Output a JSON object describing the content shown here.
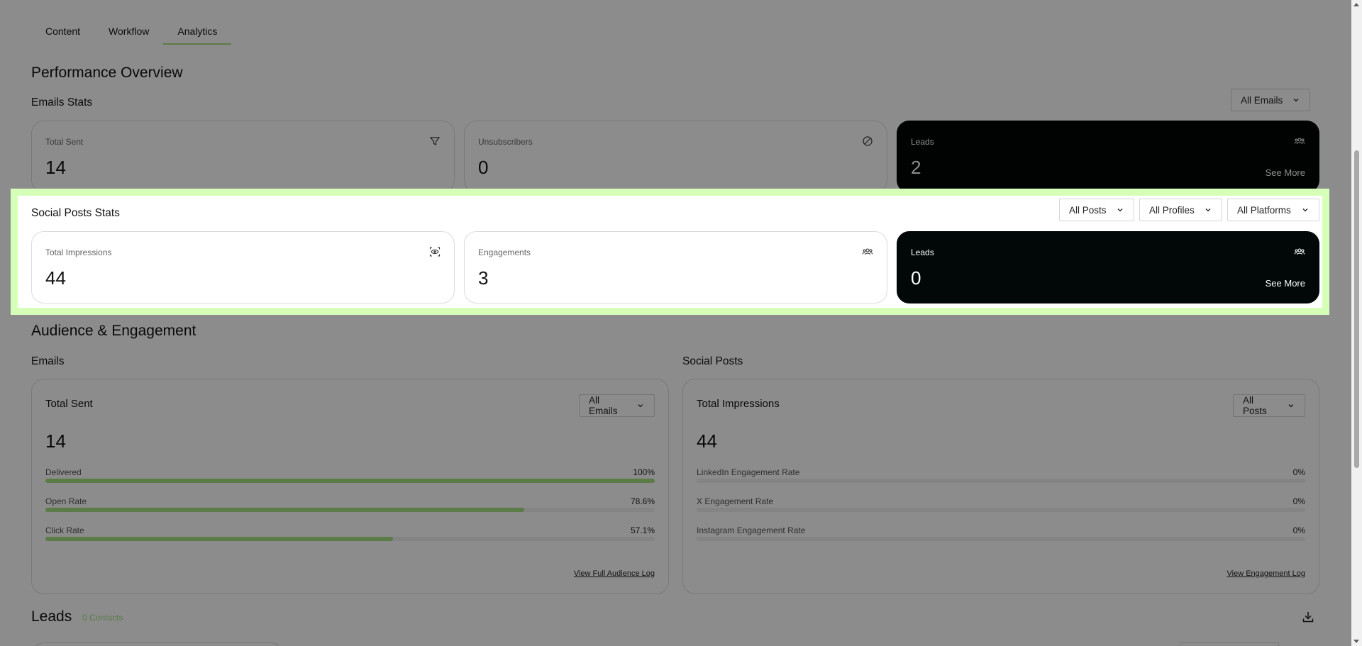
{
  "tabs": [
    {
      "label": "Content"
    },
    {
      "label": "Workflow"
    },
    {
      "label": "Analytics"
    }
  ],
  "performance": {
    "title": "Performance Overview",
    "emails_stats": {
      "title": "Emails Stats",
      "filter": "All Emails",
      "cards": [
        {
          "label": "Total Sent",
          "value": "14",
          "icon": "filter-icon"
        },
        {
          "label": "Unsubscribers",
          "value": "0",
          "icon": "prohibited-icon"
        },
        {
          "label": "Leads",
          "value": "2",
          "icon": "users-icon",
          "link": "See More"
        }
      ]
    },
    "social_stats": {
      "title": "Social Posts Stats",
      "filters": [
        "All Posts",
        "All Profiles",
        "All Platforms"
      ],
      "cards": [
        {
          "label": "Total Impressions",
          "value": "44",
          "icon": "eye-scan-icon"
        },
        {
          "label": "Engagements",
          "value": "3",
          "icon": "users-icon"
        },
        {
          "label": "Leads",
          "value": "0",
          "icon": "users-icon",
          "link": "See More"
        }
      ]
    }
  },
  "audience": {
    "title": "Audience & Engagement",
    "emails": {
      "section": "Emails",
      "title": "Total Sent",
      "filter": "All Emails",
      "value": "14",
      "metrics": [
        {
          "label": "Delivered",
          "value": "100%",
          "fraction": 1.0
        },
        {
          "label": "Open Rate",
          "value": "78.6%",
          "fraction": 0.786
        },
        {
          "label": "Click Rate",
          "value": "57.1%",
          "fraction": 0.571
        }
      ],
      "link": "View Full Audience Log"
    },
    "social": {
      "section": "Social Posts",
      "title": "Total Impressions",
      "filter": "All Posts",
      "value": "44",
      "metrics": [
        {
          "label": "LinkedIn Engagement Rate",
          "value": "0%",
          "fraction": 0
        },
        {
          "label": "X Engagement Rate",
          "value": "0%",
          "fraction": 0
        },
        {
          "label": "Instagram Engagement Rate",
          "value": "0%",
          "fraction": 0
        }
      ],
      "link": "View Engagement Log"
    }
  },
  "leads": {
    "title": "Leads",
    "count": "0 Contacts"
  },
  "colors": {
    "accent": "#a6e183",
    "highlight": "#d6ffb8",
    "dark_card": "#020707"
  }
}
